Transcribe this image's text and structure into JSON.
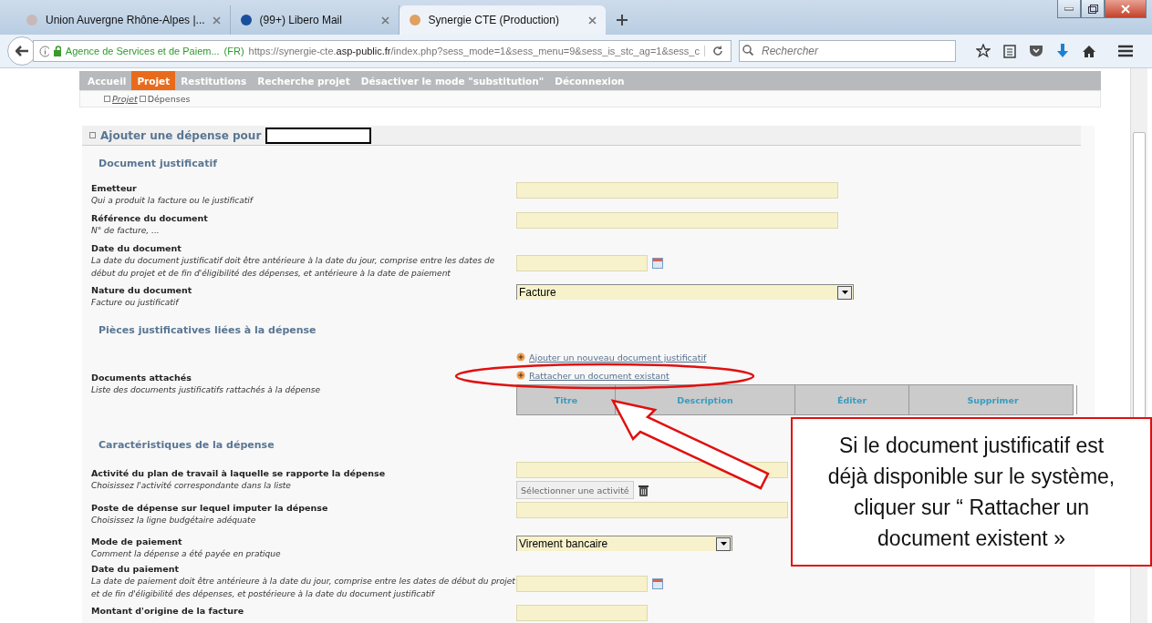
{
  "browser": {
    "tabs": [
      {
        "title": "Union Auvergne Rhône-Alpes |...",
        "selected": false
      },
      {
        "title": "(99+) Libero Mail",
        "selected": false
      },
      {
        "title": "Synergie CTE (Production)",
        "selected": true
      }
    ],
    "address": {
      "identity": "Agence de Services et de Paiem...",
      "country": "(FR)",
      "url": "https://synergie-cte.**asp-public.fr**/index.php?sess_mode=1&sess_menu=9&sess_is_stc_ag=1&sess_c"
    },
    "search": {
      "placeholder": "Rechercher"
    }
  },
  "nav": {
    "items": [
      {
        "label": "Accueil",
        "selected": false
      },
      {
        "label": "Projet",
        "selected": true
      },
      {
        "label": "Restitutions",
        "selected": false
      },
      {
        "label": "Recherche projet",
        "selected": false
      },
      {
        "label": "Désactiver le mode \"substitution\"",
        "selected": false
      },
      {
        "label": "Déconnexion",
        "selected": false
      }
    ]
  },
  "breadcrumb": [
    {
      "label": "Projet",
      "kind": "link"
    },
    {
      "label": "Dépenses",
      "kind": "current"
    }
  ],
  "form": {
    "title": "Ajouter une dépense pour",
    "sections": [
      {
        "heading": "Document justificatif",
        "rows": [
          {
            "kind": "text",
            "wide": true,
            "label": "Emetteur",
            "hint": "Qui a produit la facture ou le justificatif"
          },
          {
            "kind": "text",
            "wide": true,
            "label": "Référence du document",
            "hint": "N° de facture, ..."
          },
          {
            "kind": "date",
            "label": "Date du document",
            "hint": "La date du document justificatif doit être antérieure à la date du jour, comprise entre les dates de début du projet et de fin d'éligibilité des dépenses, et antérieure à la date de paiement"
          },
          {
            "kind": "select",
            "wide": true,
            "label": "Nature du document",
            "hint": "Facture ou justificatif",
            "value": "Facture"
          }
        ]
      },
      {
        "heading": "Pièces justificatives liées à la dépense",
        "rows": [
          {
            "kind": "attachments",
            "label": "Documents attachés",
            "hint": "Liste des documents justificatifs rattachés à la dépense",
            "links": [
              "Ajouter un nouveau document justificatif",
              "Rattacher un document existant"
            ],
            "columns": [
              "Titre",
              "Description",
              "Éditer",
              "Supprimer"
            ]
          }
        ]
      },
      {
        "heading": "Caractéristiques de la dépense",
        "rows": [
          {
            "kind": "picker",
            "label": "Activité du plan de travail à laquelle se rapporte la dépense",
            "hint": "Choisissez l'activité correspondante dans la liste",
            "button": "Sélectionner une activité"
          },
          {
            "kind": "text",
            "wide": false,
            "label": "Poste de dépense sur lequel imputer la dépense",
            "hint": "Choisissez la ligne budgétaire adéquate"
          },
          {
            "kind": "select",
            "wide": false,
            "label": "Mode de paiement",
            "hint": "Comment la dépense a été payée en pratique",
            "value": "Virement bancaire"
          },
          {
            "kind": "date",
            "label": "Date du paiement",
            "hint": "La date de paiement doit être antérieure à la date du jour, comprise entre les dates de début du projet et de fin d'éligibilité des dépenses, et postérieure à la date du document justificatif"
          },
          {
            "kind": "amount",
            "label": "Montant d'origine de la facture"
          }
        ]
      }
    ]
  },
  "callout": {
    "text": "Si le document justificatif est déjà disponible sur le système, cliquer sur “ Rattacher un document existent »"
  }
}
